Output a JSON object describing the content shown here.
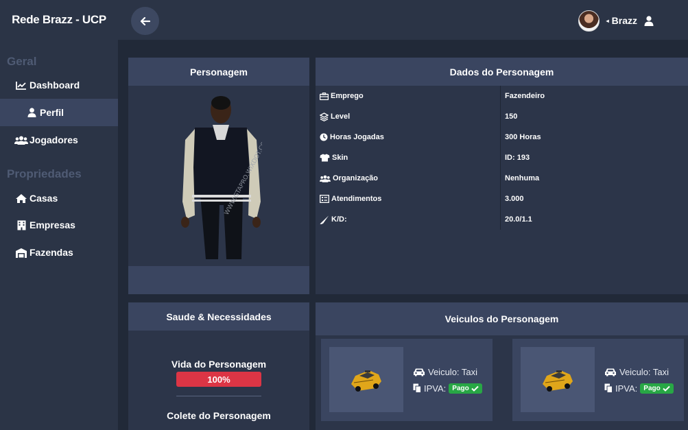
{
  "header": {
    "brand": "Rede Brazz - UCP",
    "user_name": "Brazz"
  },
  "sidebar": {
    "sections": [
      {
        "title": "Geral",
        "items": [
          {
            "label": "Dashboard",
            "icon": "chart-line-icon"
          },
          {
            "label": "Perfil",
            "icon": "user-icon",
            "active": true
          },
          {
            "label": "Jogadores",
            "icon": "users-icon"
          }
        ]
      },
      {
        "title": "Propriedades",
        "items": [
          {
            "label": "Casas",
            "icon": "home-icon"
          },
          {
            "label": "Empresas",
            "icon": "building-icon"
          },
          {
            "label": "Fazendas",
            "icon": "warehouse-icon"
          }
        ]
      }
    ]
  },
  "personagem": {
    "title": "Personagem",
    "watermark": "WWW.GTAPRO.WIXDOT.COM"
  },
  "dados": {
    "title": "Dados do Personagem",
    "rows": [
      {
        "label": "Emprego",
        "value": "Fazendeiro",
        "icon": "briefcase-icon"
      },
      {
        "label": "Level",
        "value": "150",
        "icon": "layers-icon"
      },
      {
        "label": "Horas Jogadas",
        "value": "300 Horas",
        "icon": "clock-icon"
      },
      {
        "label": "Skin",
        "value": "ID: 193",
        "icon": "shirt-icon"
      },
      {
        "label": "Organização",
        "value": "Nenhuma",
        "icon": "users-icon"
      },
      {
        "label": "Atendimentos",
        "value": "3.000",
        "icon": "list-alt-icon"
      },
      {
        "label": "K/D:",
        "value": "20.0/1.1",
        "icon": "knife-icon"
      }
    ]
  },
  "saude": {
    "title": "Saude & Necessidades",
    "vida_label": "Vida do Personagem",
    "vida_value": "100%",
    "vida_fraction": 1.0,
    "colete_label": "Colete do Personagem"
  },
  "veiculos": {
    "title": "Veiculos do Personagem",
    "items": [
      {
        "veiculo": "Veiculo: Taxi",
        "ipva": "IPVA:",
        "status": "Pago"
      },
      {
        "veiculo": "Veiculo: Taxi",
        "ipva": "IPVA:",
        "status": "Pago"
      }
    ]
  },
  "colors": {
    "background": "#212938",
    "panel": "#2c3549",
    "panel_header": "#3a4560",
    "danger": "#dc3545",
    "success": "#28a745"
  }
}
